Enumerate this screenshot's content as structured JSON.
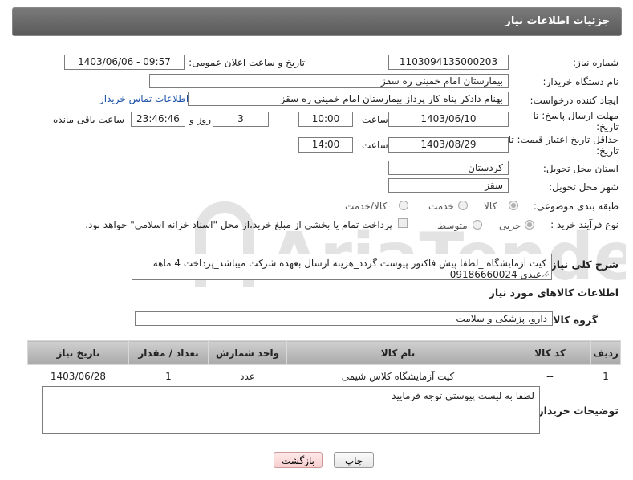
{
  "header": {
    "title": "جزئیات اطلاعات نیاز"
  },
  "need_number": {
    "label": "شماره نیاز:",
    "value": "1103094135000203"
  },
  "announce_date": {
    "label": "تاریخ و ساعت اعلان عمومی:",
    "value": "1403/06/06 - 09:57"
  },
  "buyer_org": {
    "label": "نام دستگاه خریدار:",
    "value": "بیمارستان امام خمینی  ره  سقز"
  },
  "requester": {
    "label": "ایجاد کننده درخواست:",
    "value": "بهنام دادکر پناه کار پرداز بیمارستان امام خمینی  ره  سقز",
    "contact_link": "اطلاعات تماس خریدار"
  },
  "reply_deadline": {
    "label_line1": "مهلت ارسال پاسخ: تا",
    "label_line2": "تاریخ:",
    "date": "1403/06/10",
    "time_label": "ساعت",
    "time": "10:00",
    "days": "3",
    "days_label": "روز و",
    "remaining": "23:46:46",
    "remaining_label": "ساعت باقی مانده"
  },
  "price_validity": {
    "label_line1": "حداقل تاریخ اعتبار قیمت: تا",
    "label_line2": "تاریخ:",
    "date": "1403/08/29",
    "time_label": "ساعت",
    "time": "14:00"
  },
  "province": {
    "label": "استان محل تحویل:",
    "value": "کردستان"
  },
  "city": {
    "label": "شهر محل تحویل:",
    "value": "سقز"
  },
  "category": {
    "label": "طبقه بندی موضوعی:",
    "options": [
      "کالا",
      "خدمت",
      "کالا/خدمت"
    ],
    "selected": "کالا"
  },
  "process": {
    "label": "نوع فرآیند خرید :",
    "options": [
      "جزیی",
      "متوسط"
    ],
    "selected": "جزیی",
    "payment_note": "پرداخت تمام یا بخشی از مبلغ خرید،از محل \"اسناد خزانه اسلامی\" خواهد بود."
  },
  "description": {
    "label": "شرح کلی نیاز:",
    "value": "کیت آزمایشگاه _لطفا پیش فاکتور پیوست گردد_هزینه ارسال بعهده شرکت میباشد_پرداخت 4 ماهه _عبدی 09186660024"
  },
  "goods_section": {
    "title": "اطلاعات کالاهای مورد نیاز"
  },
  "goods_group": {
    "label": "گروه کالا:",
    "value": "دارو، پزشکی و سلامت"
  },
  "table": {
    "headers": [
      "ردیف",
      "کد کالا",
      "نام کالا",
      "واحد شمارش",
      "تعداد / مقدار",
      "تاریخ نیاز"
    ],
    "rows": [
      [
        "1",
        "--",
        "کیت آزمایشگاه کلاس شیمی",
        "عدد",
        "1",
        "1403/06/28"
      ]
    ]
  },
  "buyer_notes": {
    "label": "توضیحات خریدار:",
    "value": "لطفا به لیست پیوستی توجه فرمایید"
  },
  "buttons": {
    "print": "چاپ",
    "back": "بازگشت"
  },
  "watermark": {
    "text": "AriaTender.neT"
  }
}
